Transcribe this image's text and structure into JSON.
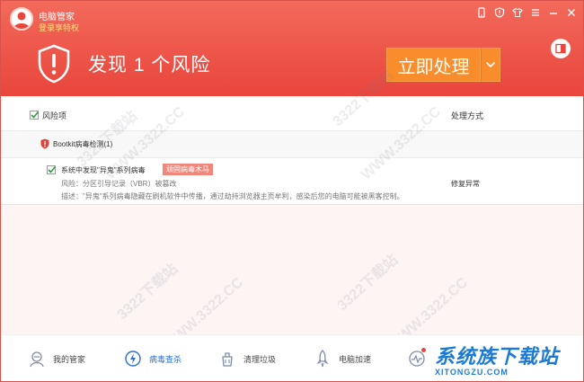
{
  "app": {
    "title": "电脑管家",
    "login_link": "登录享特权"
  },
  "header": {
    "headline": "发现 1 个风险",
    "action_button": "立即处理"
  },
  "table": {
    "col_risk": "风险项",
    "col_method": "处理方式"
  },
  "group": {
    "label": "Bootkit病毒检测(1)"
  },
  "item": {
    "name": "系统中发现\"异鬼\"系列病毒",
    "tag": "顽固病毒木马",
    "risk_line": "风险：分区引导记录（VBR）被篡改",
    "desc_line": "描述：\"异鬼\"系列病毒隐藏在刷机软件中传播，通过劫持浏览器主页牟利，感染后您的电脑可能被黑客控制。",
    "fix_label": "修复异常"
  },
  "nav": [
    {
      "label": "我的管家",
      "icon": "manager-icon"
    },
    {
      "label": "病毒查杀",
      "icon": "virus-scan-icon"
    },
    {
      "label": "清理垃圾",
      "icon": "clean-icon"
    },
    {
      "label": "电脑加速",
      "icon": "rocket-icon"
    }
  ],
  "watermarks": [
    "3322下载站",
    "WWW.3322.CC"
  ],
  "brand": {
    "cn": "系统族下载站",
    "en": "XITONGZU.COM"
  },
  "colors": {
    "header_red": "#e9453c",
    "action_orange": "#f98d2c",
    "tag_red": "#f0877a",
    "nav_active": "#2b6ed8"
  }
}
